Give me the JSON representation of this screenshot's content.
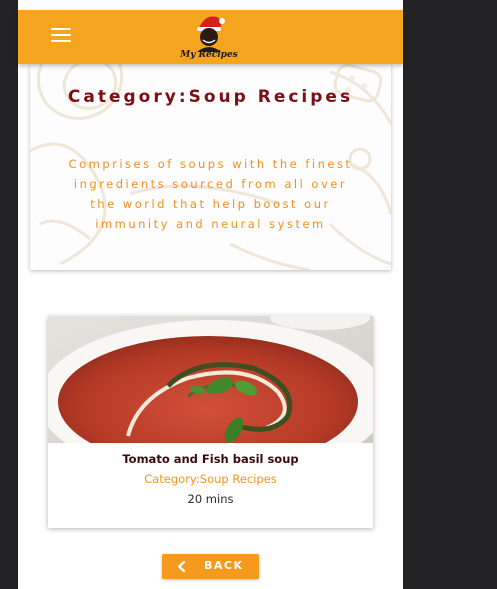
{
  "header": {
    "menu_icon": "hamburger-menu-icon",
    "logo_text": "My Recipes",
    "background": "#f5a41e"
  },
  "category": {
    "title": "Category:Soup Recipes",
    "description": "Comprises of soups with the finest ingredients sourced from all over the world that help boost our immunity and neural system"
  },
  "recipe_card": {
    "title": "Tomato and Fish basil soup",
    "category": "Category:Soup Recipes",
    "duration": "20 mins"
  },
  "back_button": {
    "icon": "chevron-left-icon",
    "label": "BACK",
    "background": "#f59a1c"
  },
  "colors": {
    "accent": "#f5a41e",
    "title_text": "#7a0f14",
    "description_text": "#f0901c",
    "page_bg": "#232325"
  }
}
